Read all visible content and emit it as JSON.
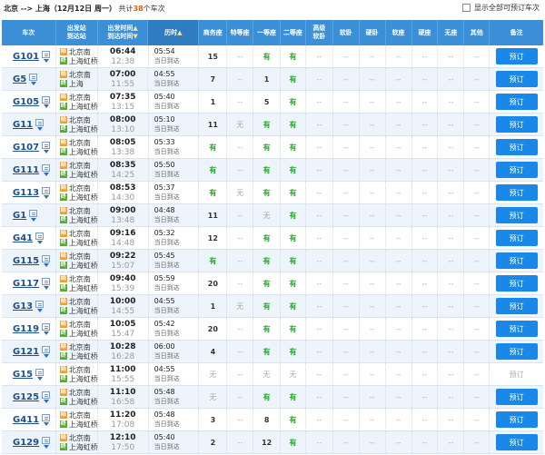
{
  "topbar": {
    "route": "北京 --> 上海（12月12日 周一）",
    "count_prefix": "共计",
    "count": "38",
    "count_suffix": "个车次",
    "show_all_label": "显示全部可预订车次"
  },
  "header": {
    "train": "车次",
    "station_top": "出发站",
    "station_bottom": "到达站",
    "time_top": "出发时间",
    "time_bottom": "到达时间",
    "duration": "历时",
    "business": "商务座",
    "premium": "特等座",
    "first": "一等座",
    "second": "二等座",
    "soft_sleeper_premium_top": "高级",
    "soft_sleeper_premium_bottom": "软卧",
    "soft_sleeper": "软卧",
    "hard_sleeper": "硬卧",
    "soft_seat": "软座",
    "hard_seat": "硬座",
    "no_seat": "无座",
    "other": "其他",
    "remark": "备注"
  },
  "rows": [
    {
      "train": "G101",
      "from": "北京南",
      "to": "上海虹桥",
      "dep": "06:44",
      "arr": "12:38",
      "dur": "05:54",
      "note": "当日到达",
      "seats": [
        "15",
        "--",
        "有",
        "有",
        "--",
        "--",
        "--",
        "--",
        "--",
        "--",
        "--"
      ],
      "book": "预订",
      "bookable": true
    },
    {
      "train": "G5",
      "from": "北京南",
      "to": "上海",
      "dep": "07:00",
      "arr": "11:55",
      "dur": "04:55",
      "note": "当日到达",
      "seats": [
        "7",
        "--",
        "1",
        "有",
        "--",
        "--",
        "--",
        "--",
        "--",
        "--",
        "--"
      ],
      "book": "预订",
      "bookable": true
    },
    {
      "train": "G105",
      "from": "北京南",
      "to": "上海虹桥",
      "dep": "07:35",
      "arr": "13:15",
      "dur": "05:40",
      "note": "当日到达",
      "seats": [
        "1",
        "--",
        "5",
        "有",
        "--",
        "--",
        "--",
        "--",
        "--",
        "--",
        "--"
      ],
      "book": "预订",
      "bookable": true
    },
    {
      "train": "G11",
      "from": "北京南",
      "to": "上海虹桥",
      "dep": "08:00",
      "arr": "13:10",
      "dur": "05:10",
      "note": "当日到达",
      "seats": [
        "11",
        "无",
        "有",
        "有",
        "--",
        "--",
        "--",
        "--",
        "--",
        "--",
        "--"
      ],
      "book": "预订",
      "bookable": true
    },
    {
      "train": "G107",
      "from": "北京南",
      "to": "上海虹桥",
      "dep": "08:05",
      "arr": "13:38",
      "dur": "05:33",
      "note": "当日到达",
      "seats": [
        "有",
        "--",
        "有",
        "有",
        "--",
        "--",
        "--",
        "--",
        "--",
        "--",
        "--"
      ],
      "book": "预订",
      "bookable": true
    },
    {
      "train": "G111",
      "from": "北京南",
      "to": "上海虹桥",
      "dep": "08:35",
      "arr": "14:25",
      "dur": "05:50",
      "note": "当日到达",
      "seats": [
        "有",
        "--",
        "有",
        "有",
        "--",
        "--",
        "--",
        "--",
        "--",
        "--",
        "--"
      ],
      "book": "预订",
      "bookable": true
    },
    {
      "train": "G113",
      "from": "北京南",
      "to": "上海虹桥",
      "dep": "08:53",
      "arr": "14:30",
      "dur": "05:37",
      "note": "当日到达",
      "seats": [
        "有",
        "无",
        "有",
        "有",
        "--",
        "--",
        "--",
        "--",
        "--",
        "--",
        "--"
      ],
      "book": "预订",
      "bookable": true
    },
    {
      "train": "G1",
      "from": "北京南",
      "to": "上海虹桥",
      "dep": "09:00",
      "arr": "13:48",
      "dur": "04:48",
      "note": "当日到达",
      "seats": [
        "11",
        "--",
        "无",
        "有",
        "--",
        "--",
        "--",
        "--",
        "--",
        "--",
        "--"
      ],
      "book": "预订",
      "bookable": true
    },
    {
      "train": "G41",
      "from": "北京南",
      "to": "上海虹桥",
      "dep": "09:16",
      "arr": "14:48",
      "dur": "05:32",
      "note": "当日到达",
      "seats": [
        "12",
        "--",
        "有",
        "有",
        "--",
        "--",
        "--",
        "--",
        "--",
        "--",
        "--"
      ],
      "book": "预订",
      "bookable": true
    },
    {
      "train": "G115",
      "from": "北京南",
      "to": "上海虹桥",
      "dep": "09:22",
      "arr": "15:07",
      "dur": "05:45",
      "note": "当日到达",
      "seats": [
        "有",
        "--",
        "有",
        "有",
        "--",
        "--",
        "--",
        "--",
        "--",
        "--",
        "--"
      ],
      "book": "预订",
      "bookable": true
    },
    {
      "train": "G117",
      "from": "北京南",
      "to": "上海虹桥",
      "dep": "09:40",
      "arr": "15:39",
      "dur": "05:59",
      "note": "当日到达",
      "seats": [
        "20",
        "--",
        "有",
        "有",
        "--",
        "--",
        "--",
        "--",
        "--",
        "--",
        "--"
      ],
      "book": "预订",
      "bookable": true
    },
    {
      "train": "G13",
      "from": "北京南",
      "to": "上海虹桥",
      "dep": "10:00",
      "arr": "14:55",
      "dur": "04:55",
      "note": "当日到达",
      "seats": [
        "1",
        "无",
        "有",
        "有",
        "--",
        "--",
        "--",
        "--",
        "--",
        "--",
        "--"
      ],
      "book": "预订",
      "bookable": true
    },
    {
      "train": "G119",
      "from": "北京南",
      "to": "上海虹桥",
      "dep": "10:05",
      "arr": "15:47",
      "dur": "05:42",
      "note": "当日到达",
      "seats": [
        "20",
        "--",
        "有",
        "有",
        "--",
        "--",
        "--",
        "--",
        "--",
        "--",
        "--"
      ],
      "book": "预订",
      "bookable": true
    },
    {
      "train": "G121",
      "from": "北京南",
      "to": "上海虹桥",
      "dep": "10:28",
      "arr": "16:28",
      "dur": "06:00",
      "note": "当日到达",
      "seats": [
        "4",
        "--",
        "有",
        "有",
        "--",
        "--",
        "--",
        "--",
        "--",
        "--",
        "--"
      ],
      "book": "预订",
      "bookable": true
    },
    {
      "train": "G15",
      "from": "北京南",
      "to": "上海虹桥",
      "dep": "11:00",
      "arr": "15:55",
      "dur": "04:55",
      "note": "当日到达",
      "seats": [
        "无",
        "--",
        "无",
        "无",
        "--",
        "--",
        "--",
        "--",
        "--",
        "--",
        "--"
      ],
      "book": "预订",
      "bookable": false
    },
    {
      "train": "G125",
      "from": "北京南",
      "to": "上海虹桥",
      "dep": "11:10",
      "arr": "16:58",
      "dur": "05:48",
      "note": "当日到达",
      "seats": [
        "无",
        "--",
        "有",
        "有",
        "--",
        "--",
        "--",
        "--",
        "--",
        "--",
        "--"
      ],
      "book": "预订",
      "bookable": true
    },
    {
      "train": "G411",
      "from": "北京南",
      "to": "上海虹桥",
      "dep": "11:20",
      "arr": "17:08",
      "dur": "05:48",
      "note": "当日到达",
      "seats": [
        "3",
        "--",
        "8",
        "有",
        "--",
        "--",
        "--",
        "--",
        "--",
        "--",
        "--"
      ],
      "book": "预订",
      "bookable": true
    },
    {
      "train": "G129",
      "from": "北京南",
      "to": "上海虹桥",
      "dep": "12:10",
      "arr": "17:50",
      "dur": "05:40",
      "note": "当日到达",
      "seats": [
        "2",
        "--",
        "12",
        "有",
        "--",
        "--",
        "--",
        "--",
        "--",
        "--",
        "--"
      ],
      "book": "预订",
      "bookable": true
    }
  ],
  "badges": {
    "start": "始",
    "end": "终",
    "via": "过"
  },
  "colors": {
    "header_bg": "#3a8fd6",
    "book_button": "#1a88e8",
    "available": "#26a52a",
    "train_link": "#1d4f91"
  }
}
